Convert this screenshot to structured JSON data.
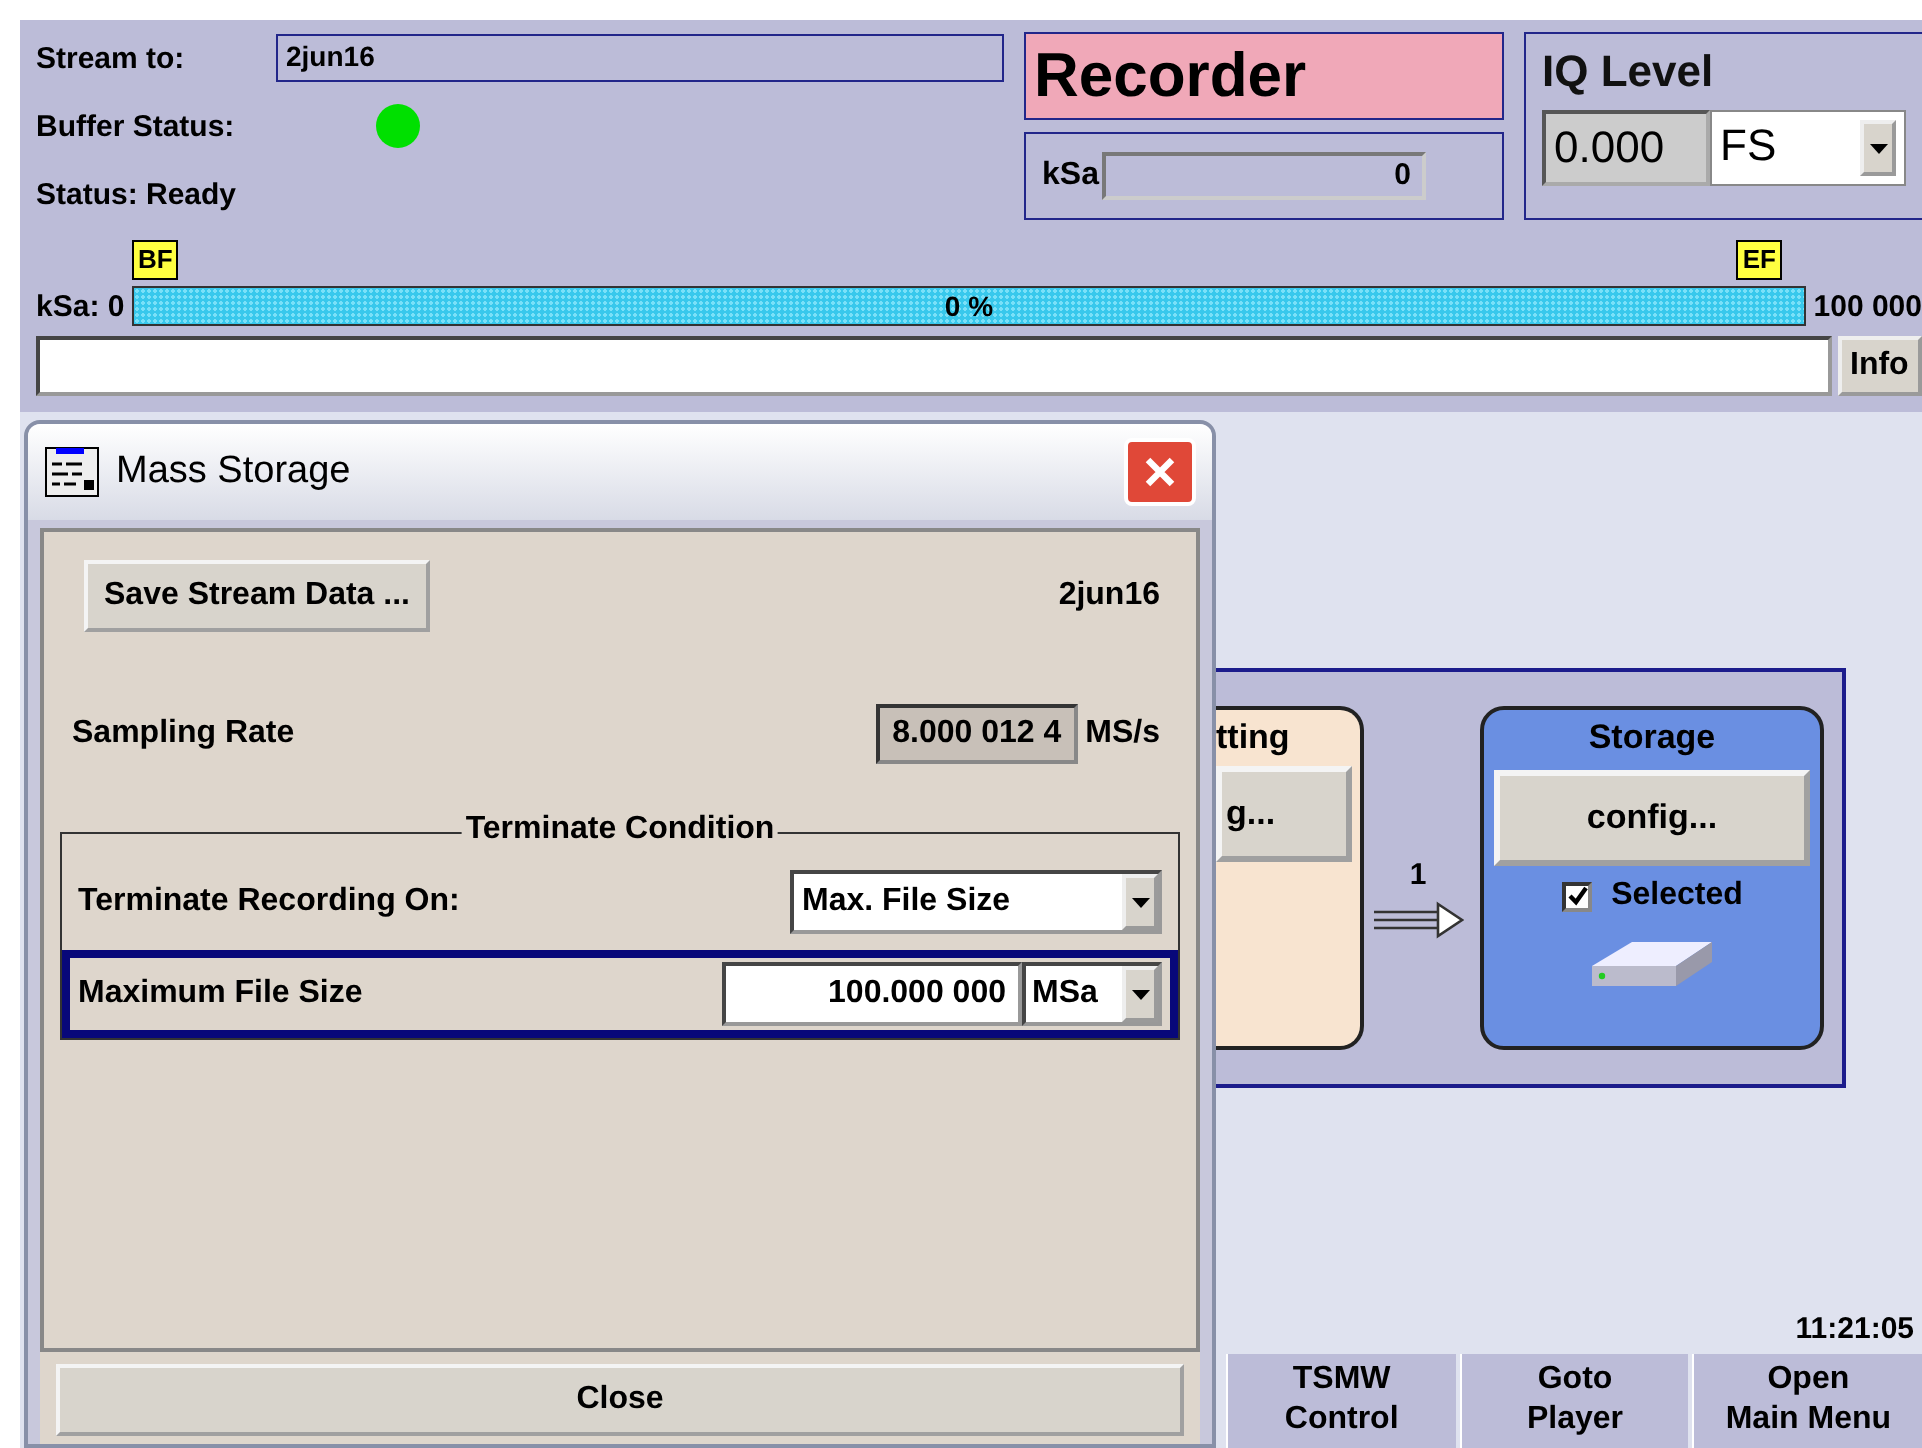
{
  "header": {
    "stream_to_label": "Stream to:",
    "stream_to_value": "2jun16",
    "buffer_status_label": "Buffer Status:",
    "buffer_ok": true,
    "status": "Status: Ready"
  },
  "recorder": {
    "title": "Recorder",
    "unit": "kSa",
    "value": "0"
  },
  "iq_level": {
    "title": "IQ Level",
    "value": "0.000",
    "unit": "FS"
  },
  "progress": {
    "start_label": "kSa: 0",
    "begin_marker": "BF",
    "end_marker": "EF",
    "level": 1,
    "reading": "0 %",
    "end_label": "100 000"
  },
  "info_button": "Info",
  "diagram": {
    "partial_title": "tting",
    "partial_button": "g...",
    "arrow_label": "1",
    "storage_title": "Storage",
    "storage_button": "config...",
    "selected_label": "Selected",
    "selected": true
  },
  "clock": "11:21:05",
  "softkeys": [
    {
      "lines": [
        "TSMW",
        "Control"
      ]
    },
    {
      "lines": [
        "Goto",
        "Player"
      ]
    },
    {
      "lines": [
        "Open",
        "Main Menu"
      ]
    }
  ],
  "dialog": {
    "title": "Mass Storage",
    "save_button": "Save Stream Data ...",
    "file_name": "2jun16",
    "sampling_rate_label": "Sampling Rate",
    "sampling_rate_value": "8.000 012 4",
    "sampling_rate_unit": "MS/s",
    "group_title": "Terminate Condition",
    "terminate_label": "Terminate Recording On:",
    "terminate_value": "Max. File Size",
    "max_size_label": "Maximum File Size",
    "max_size_value": "100.000 000",
    "max_size_unit": "MSa",
    "close_button": "Close"
  }
}
